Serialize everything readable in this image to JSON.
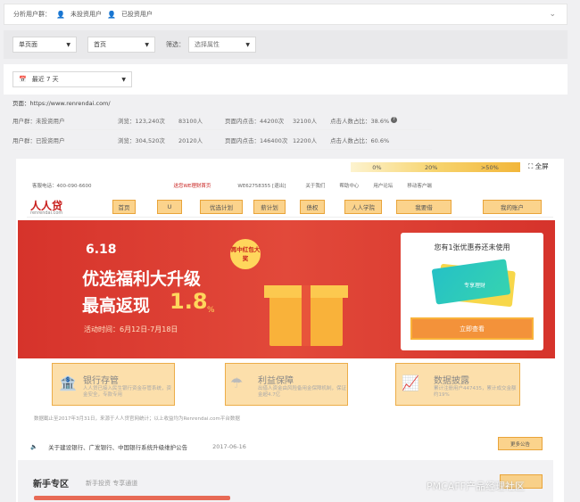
{
  "filters": {
    "group_label": "分析用户群：",
    "group1": "未投资用户",
    "group2": "已投资用户",
    "page_type": "单页面",
    "page": "首页",
    "filter_label": "筛选：",
    "filter_placeholder": "选择属性",
    "date_range": "最近 7 天"
  },
  "stats": {
    "page_url": "页面：https://www.renrendai.com/",
    "rows": [
      {
        "group": "用户群：未投资用户",
        "views_label": "浏览：123,240次",
        "users": "83100人",
        "clicks": "页面内点击：44200次",
        "click_users": "32100人",
        "ratio": "点击人数占比：38.6%",
        "help": "?"
      },
      {
        "group": "用户群：已投资用户",
        "views_label": "浏览：304,520次",
        "users": "20120人",
        "clicks": "页面内点击：146400次",
        "click_users": "12200人",
        "ratio": "点击人数占比：60.6%",
        "help": ""
      }
    ]
  },
  "heatmap": {
    "legend": [
      "0%",
      "20%",
      ">50%"
    ],
    "fullscreen": "全屏"
  },
  "site": {
    "topnav": [
      "客服电话：400-090-6600",
      "送您WE理财首页",
      "WE62758355 [退出]",
      "关于我们",
      "帮助中心",
      "用户论坛",
      "移动客户端"
    ],
    "logo": "人人贷",
    "logo_sub": "renrendai.com",
    "nav": [
      "首页",
      "U",
      "优选计划",
      "薪计划",
      "债权",
      "人人学院",
      "我要借",
      "我的账户"
    ],
    "banner": {
      "date": "6.18",
      "line1": "优选福利大升级",
      "line2": "最高返现",
      "big": "1.8",
      "pct": "%",
      "time": "活动时间：6月12日-7月18日",
      "badge": "再中红包大奖",
      "coupon_title": "您有1张优惠券还未使用",
      "coupon_btn": "立即查看",
      "ticket": "专享理财"
    },
    "features": [
      {
        "title": "银行存管",
        "desc": "人人贷已接入民生银行资金存管系统，资金安全，专款专用"
      },
      {
        "title": "利益保障",
        "desc": "出借人资金由风险备用金保障机制，保证金超4.7亿"
      },
      {
        "title": "数据披露",
        "desc": "累计注册用户447435，累计成交金额约19%"
      }
    ],
    "note": "数据截止至2017年3月31日，来源于人人贷官网统计；以上收益均为Renrendai.com平台数据",
    "notice": "关于建设银行、广发银行、中国银行系统升级维护公告",
    "notice_date": "2017-06-16",
    "more": "更多公告",
    "newzone_title": "新手专区",
    "newzone_sub": "新手投资 专享通道"
  },
  "watermark": "PMCAFF产品经理社区"
}
